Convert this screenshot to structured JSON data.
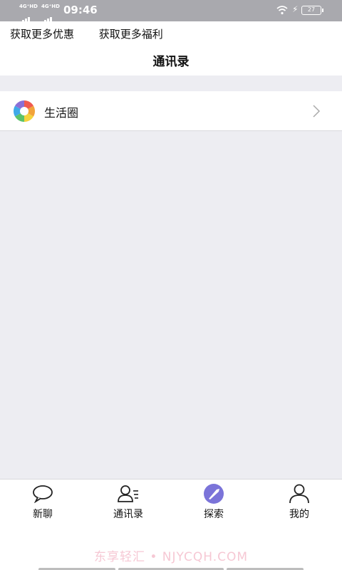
{
  "status_bar": {
    "signal1": "4G⁺HD",
    "signal2": "4G⁺HD",
    "time": "09:46",
    "battery": "27"
  },
  "header": {
    "links": [
      "获取更多优惠",
      "获取更多福利"
    ],
    "title": "通讯录"
  },
  "list": {
    "items": [
      {
        "label": "生活圈",
        "icon": "moments-aperture-icon"
      }
    ]
  },
  "tabbar": {
    "items": [
      {
        "label": "新聊",
        "icon": "chat-bubble-icon"
      },
      {
        "label": "通讯录",
        "icon": "contacts-icon"
      },
      {
        "label": "探索",
        "icon": "compass-icon"
      },
      {
        "label": "我的",
        "icon": "person-icon"
      }
    ],
    "accent": "#7b74d9"
  },
  "watermark": "东享轻汇 • NJYCQH.COM"
}
